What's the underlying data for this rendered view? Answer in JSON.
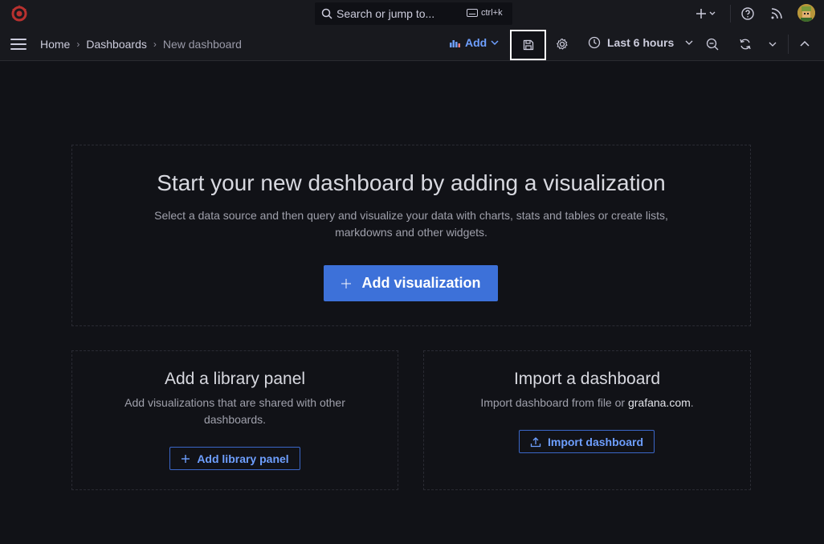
{
  "search": {
    "placeholder": "Search or jump to...",
    "shortcut": "ctrl+k"
  },
  "breadcrumb": {
    "home": "Home",
    "dashboards": "Dashboards",
    "current": "New dashboard"
  },
  "toolbar": {
    "add_label": "Add",
    "time_range": "Last 6 hours"
  },
  "empty_state": {
    "title": "Start your new dashboard by adding a visualization",
    "subtitle_line1": "Select a data source and then query and visualize your data with charts, stats and tables or create lists,",
    "subtitle_line2": "markdowns and other widgets.",
    "add_viz_label": "Add visualization"
  },
  "library_panel": {
    "title": "Add a library panel",
    "subtitle_line1": "Add visualizations that are shared with other",
    "subtitle_line2": "dashboards.",
    "button_label": "Add library panel"
  },
  "import": {
    "title": "Import a dashboard",
    "subtitle_prefix": "Import dashboard from file or ",
    "subtitle_link": "grafana.com",
    "subtitle_suffix": ".",
    "button_label": "Import dashboard"
  },
  "colors": {
    "accent": "#3d71d9",
    "link": "#6e9fff",
    "background": "#111217"
  }
}
